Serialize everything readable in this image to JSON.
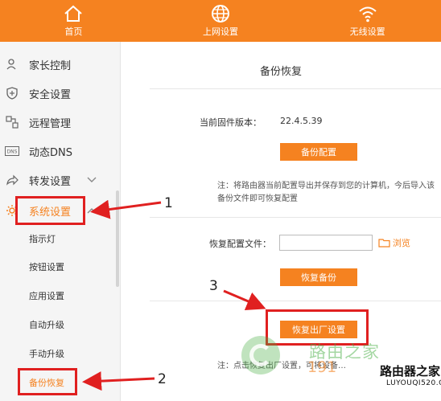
{
  "topnav": [
    {
      "label": "首页",
      "icon": "home-icon"
    },
    {
      "label": "上网设置",
      "icon": "globe-icon"
    },
    {
      "label": "无线设置",
      "icon": "wifi-icon"
    }
  ],
  "sidebar": {
    "items": [
      {
        "label": "家长控制",
        "icon": "parental-control-icon"
      },
      {
        "label": "安全设置",
        "icon": "shield-icon"
      },
      {
        "label": "远程管理",
        "icon": "remote-management-icon"
      },
      {
        "label": "动态DNS",
        "icon": "dns-icon"
      },
      {
        "label": "转发设置",
        "icon": "forward-icon"
      },
      {
        "label": "系统设置",
        "icon": "gear-icon"
      }
    ],
    "subitems": [
      "指示灯",
      "按钮设置",
      "应用设置",
      "自动升级",
      "手动升级",
      "备份恢复"
    ]
  },
  "main": {
    "title": "备份恢复",
    "firmware_label": "当前固件版本：",
    "firmware_version": "22.4.5.39",
    "backup_button": "备份配置",
    "backup_note": "注：将路由器当前配置导出并保存到您的计算机，今后导入该备份文件即可恢复配置",
    "restore_label": "恢复配置文件：",
    "restore_file_value": "",
    "browse_label": "浏览",
    "restore_button": "恢复备份",
    "factory_button": "恢复出厂设置",
    "factory_note": "注：点击恢复出厂设置，可将设备…"
  },
  "annotations": [
    "1",
    "2",
    "3"
  ],
  "watermark": {
    "cn": "路由之家",
    "number": "191",
    "brand": "路由器之家",
    "url": "LUYOUQI520.COM"
  },
  "colors": {
    "accent": "#f58220",
    "highlight": "#e02020"
  }
}
